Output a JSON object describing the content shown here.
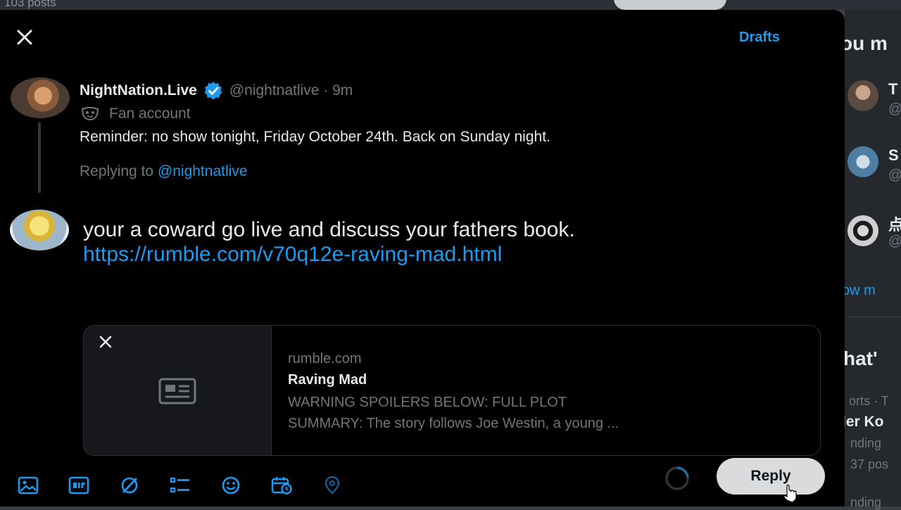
{
  "background": {
    "posts_count": "103 posts",
    "right_column": {
      "heading": "ou m",
      "items": [
        {
          "initial": "T"
        },
        {
          "initial": "S"
        },
        {
          "initial": "点"
        }
      ],
      "show_more": "ow m",
      "whats_heading": "hat'",
      "trend_meta": "orts · T",
      "trend_name": "ler Ko",
      "trend_label": "nding",
      "trend_posts": "37 pos",
      "trend_bottom": "nding"
    }
  },
  "modal": {
    "drafts_label": "Drafts",
    "original_tweet": {
      "name": "NightNation.Live",
      "handle": "@nightnatlive · 9m",
      "badge_label": "Fan account",
      "text": "Reminder: no show tonight, Friday October 24th.  Back on Sunday night.",
      "replying_prefix": "Replying to ",
      "replying_handle": "@nightnatlive"
    },
    "compose": {
      "line1": "your a coward go live and discuss your fathers book.",
      "line2": "https://rumble.com/v70q12e-raving-mad.html"
    },
    "link_card": {
      "domain": "rumble.com",
      "title": "Raving Mad",
      "description_line1": "WARNING SPOILERS BELOW: FULL PLOT",
      "description_line2": "SUMMARY: The story follows Joe Westin, a young ..."
    },
    "toolbar": {
      "icons": [
        "image-icon",
        "gif-icon",
        "grok-icon",
        "poll-icon",
        "emoji-icon",
        "schedule-icon",
        "location-icon"
      ],
      "reply_label": "Reply"
    },
    "colors": {
      "accent": "#1d9bf0",
      "modal_bg": "#000000",
      "muted_text": "#71767b"
    }
  }
}
